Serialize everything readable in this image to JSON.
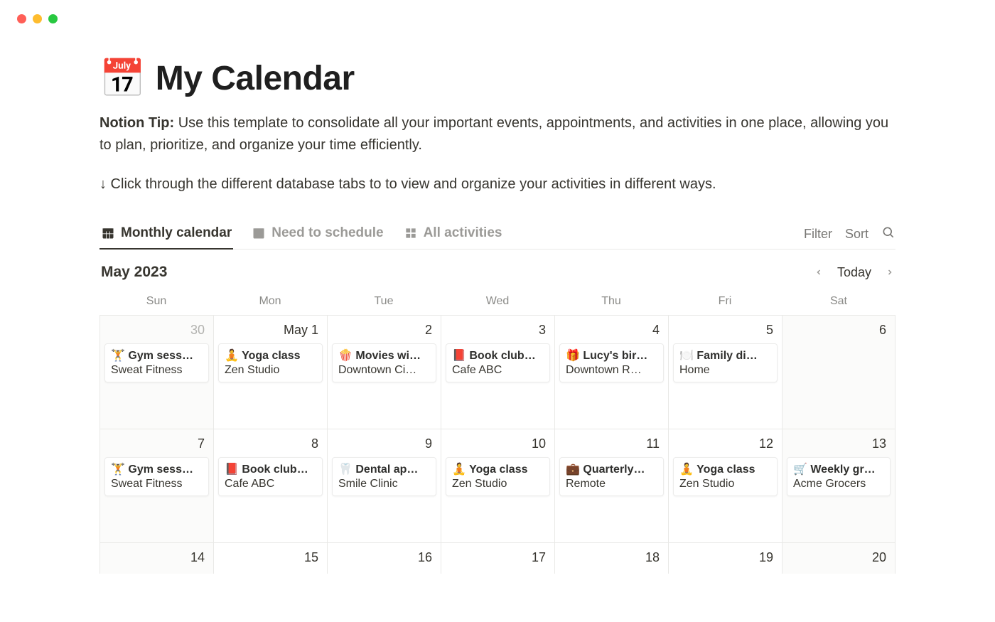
{
  "page": {
    "icon": "📅",
    "title": "My Calendar",
    "tip_label": "Notion Tip:",
    "tip_text": " Use this template to consolidate all your important events, appointments, and activities in one place, allowing you to plan, prioritize, and organize your time efficiently.",
    "subtext": "↓ Click through the different database tabs to to view and organize your activities in different ways."
  },
  "tabs": [
    {
      "label": "Monthly calendar",
      "active": true
    },
    {
      "label": "Need to schedule",
      "active": false
    },
    {
      "label": "All activities",
      "active": false
    }
  ],
  "controls": {
    "filter": "Filter",
    "sort": "Sort"
  },
  "calendar": {
    "month_label": "May 2023",
    "today_label": "Today",
    "day_headers": [
      "Sun",
      "Mon",
      "Tue",
      "Wed",
      "Thu",
      "Fri",
      "Sat"
    ],
    "weeks": [
      {
        "days": [
          {
            "num": "30",
            "faded": true,
            "dim": true,
            "event": {
              "icon": "🏋️",
              "title": "Gym sess…",
              "sub": "Sweat Fitness"
            }
          },
          {
            "num": "May 1",
            "event": {
              "icon": "🧘",
              "title": "Yoga class",
              "sub": "Zen Studio"
            }
          },
          {
            "num": "2",
            "event": {
              "icon": "🍿",
              "title": "Movies wi…",
              "sub": "Downtown Ci…"
            }
          },
          {
            "num": "3",
            "event": {
              "icon": "📕",
              "title": "Book club…",
              "sub": "Cafe ABC"
            }
          },
          {
            "num": "4",
            "event": {
              "icon": "🎁",
              "title": "Lucy's bir…",
              "sub": "Downtown R…"
            }
          },
          {
            "num": "5",
            "event": {
              "icon": "🍽️",
              "title": "Family di…",
              "sub": "Home"
            }
          },
          {
            "num": "6",
            "dim": true
          }
        ]
      },
      {
        "days": [
          {
            "num": "7",
            "dim": true,
            "event": {
              "icon": "🏋️",
              "title": "Gym sess…",
              "sub": "Sweat Fitness"
            }
          },
          {
            "num": "8",
            "event": {
              "icon": "📕",
              "title": "Book club…",
              "sub": "Cafe ABC"
            }
          },
          {
            "num": "9",
            "event": {
              "icon": "🦷",
              "title": "Dental ap…",
              "sub": "Smile Clinic"
            }
          },
          {
            "num": "10",
            "event": {
              "icon": "🧘",
              "title": "Yoga class",
              "sub": "Zen Studio"
            }
          },
          {
            "num": "11",
            "event": {
              "icon": "💼",
              "title": "Quarterly…",
              "sub": "Remote"
            }
          },
          {
            "num": "12",
            "event": {
              "icon": "🧘",
              "title": "Yoga class",
              "sub": "Zen Studio"
            }
          },
          {
            "num": "13",
            "dim": true,
            "event": {
              "icon": "🛒",
              "title": "Weekly gr…",
              "sub": "Acme Grocers"
            }
          }
        ]
      },
      {
        "days": [
          {
            "num": "14",
            "dim": true
          },
          {
            "num": "15"
          },
          {
            "num": "16"
          },
          {
            "num": "17"
          },
          {
            "num": "18"
          },
          {
            "num": "19"
          },
          {
            "num": "20",
            "dim": true
          }
        ]
      }
    ]
  }
}
